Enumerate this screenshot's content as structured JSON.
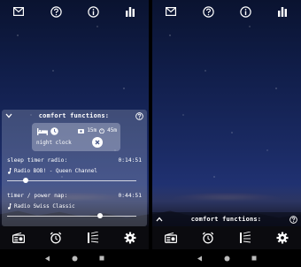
{
  "topbar": {
    "icons": [
      "mail-icon",
      "help-icon",
      "info-icon",
      "bar-chart-icon"
    ]
  },
  "comfort": {
    "title": "comfort functions:",
    "night_clock_label": "night clock",
    "duration_1": "15m",
    "duration_2": "45m"
  },
  "sleep_timer": {
    "label": "sleep timer radio:",
    "time": "0:14:51",
    "station": "Radio BOB! - Queen Channel",
    "progress": 0.12
  },
  "power_nap": {
    "label": "timer / power nap:",
    "time": "0:44:51",
    "station": "Radio Swiss Classic",
    "progress": 0.7
  },
  "bottombar": {
    "icons": [
      "radio-icon",
      "alarm-clock-icon",
      "sleep-light-icon",
      "settings-icon"
    ]
  },
  "navbar": {
    "icons": [
      "back-icon",
      "home-icon",
      "recents-icon"
    ]
  },
  "right_screen": {
    "collapsed_title": "comfort functions:"
  },
  "colors": {
    "sky_top": "#0a1330",
    "sky_bottom": "#2b3d84",
    "bar_background": "#0b0b0f"
  }
}
